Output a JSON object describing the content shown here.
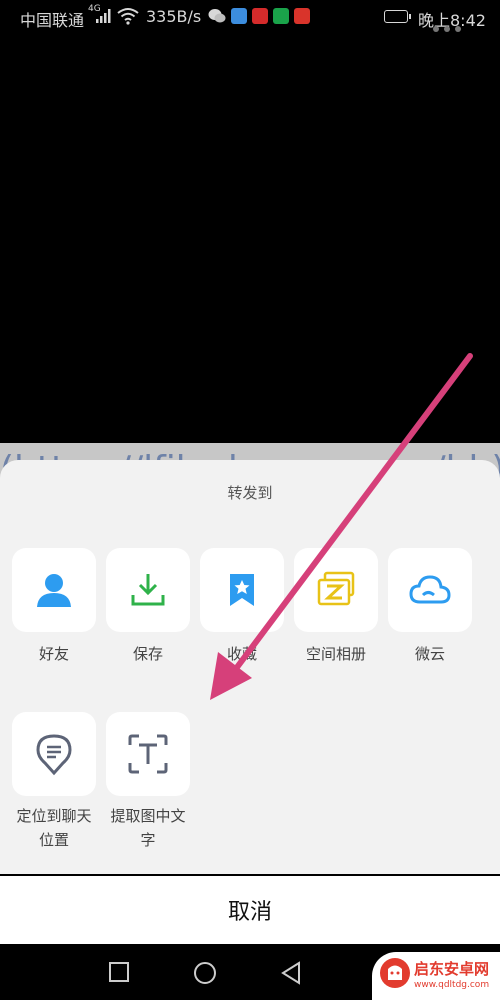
{
  "status_bar": {
    "carrier": "中国联通",
    "network": "4G",
    "speed": "335B/s",
    "time": "晚上8:42",
    "app_icon_colors": [
      "#3c8dde",
      "#d52b2b",
      "#1aa34a",
      "#d9342b"
    ]
  },
  "background": {
    "url_text": "(https://lfik.clear-sz.com/hb)"
  },
  "share_sheet": {
    "title": "转发到",
    "row1": [
      {
        "label": "好友",
        "icon": "person-icon"
      },
      {
        "label": "保存",
        "icon": "download-icon"
      },
      {
        "label": "收藏",
        "icon": "bookmark-star-icon"
      },
      {
        "label": "空间相册",
        "icon": "album-icon"
      },
      {
        "label": "微云",
        "icon": "cloud-icon"
      }
    ],
    "row2": [
      {
        "label_line1": "定位到聊天",
        "label_line2": "位置",
        "icon": "location-chat-icon"
      },
      {
        "label_line1": "提取图中文",
        "label_line2": "字",
        "icon": "text-scan-icon"
      }
    ],
    "cancel_label": "取消"
  },
  "nav_bar": {
    "buttons": [
      "recent-apps",
      "home",
      "back"
    ]
  },
  "watermark": {
    "title": "启东安卓网",
    "url": "www.qdltdg.com"
  },
  "colors": {
    "accent_blue": "#2d9cf0",
    "accent_green": "#2fb24a",
    "accent_yellow": "#e8c217",
    "arrow_pink": "#d6407a"
  }
}
